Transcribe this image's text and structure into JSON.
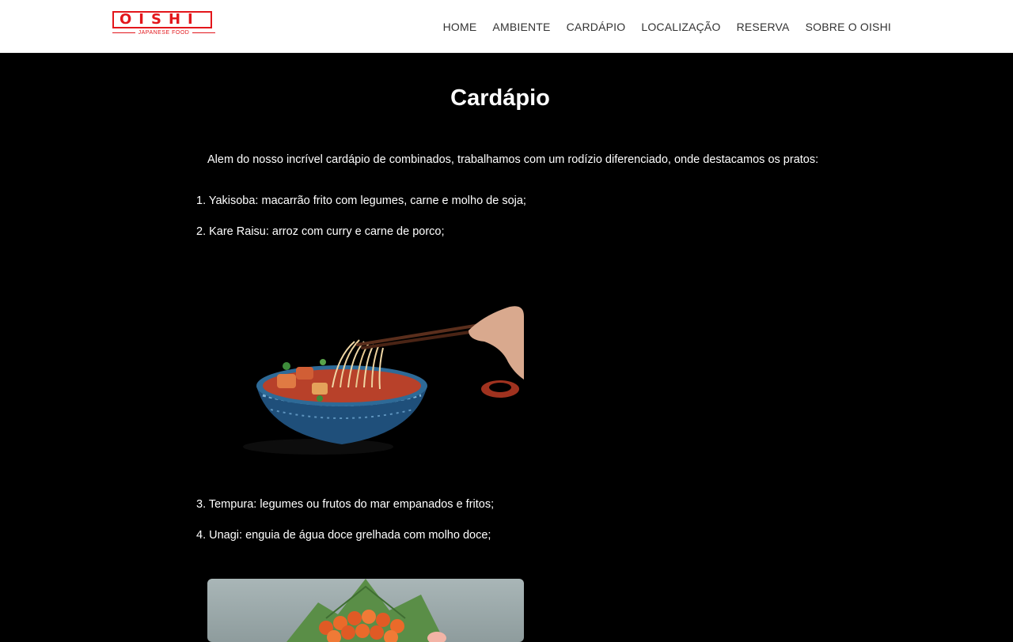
{
  "brand": {
    "logo_text": "OISHI",
    "logo_subtitle": "JAPANESE FOOD",
    "accent_color": "#e3161b"
  },
  "nav": {
    "items": [
      {
        "label": "HOME"
      },
      {
        "label": "AMBIENTE"
      },
      {
        "label": "CARDÁPIO"
      },
      {
        "label": "LOCALIZAÇÃO"
      },
      {
        "label": "RESERVA"
      },
      {
        "label": "SOBRE O OISHI"
      }
    ]
  },
  "main": {
    "title": "Cardápio",
    "intro": "Alem do nosso incrível cardápio de combinados, trabalhamos com um rodízio diferenciado, onde destacamos os pratos:",
    "dishes": [
      "1. Yakisoba: macarrão frito com legumes, carne e molho de soja;",
      "2. Kare Raisu: arroz com curry e carne de porco;",
      "3. Tempura: legumes ou frutos do mar empanados e fritos;",
      "4. Unagi: enguia de água doce grelhada com molho doce;"
    ]
  }
}
